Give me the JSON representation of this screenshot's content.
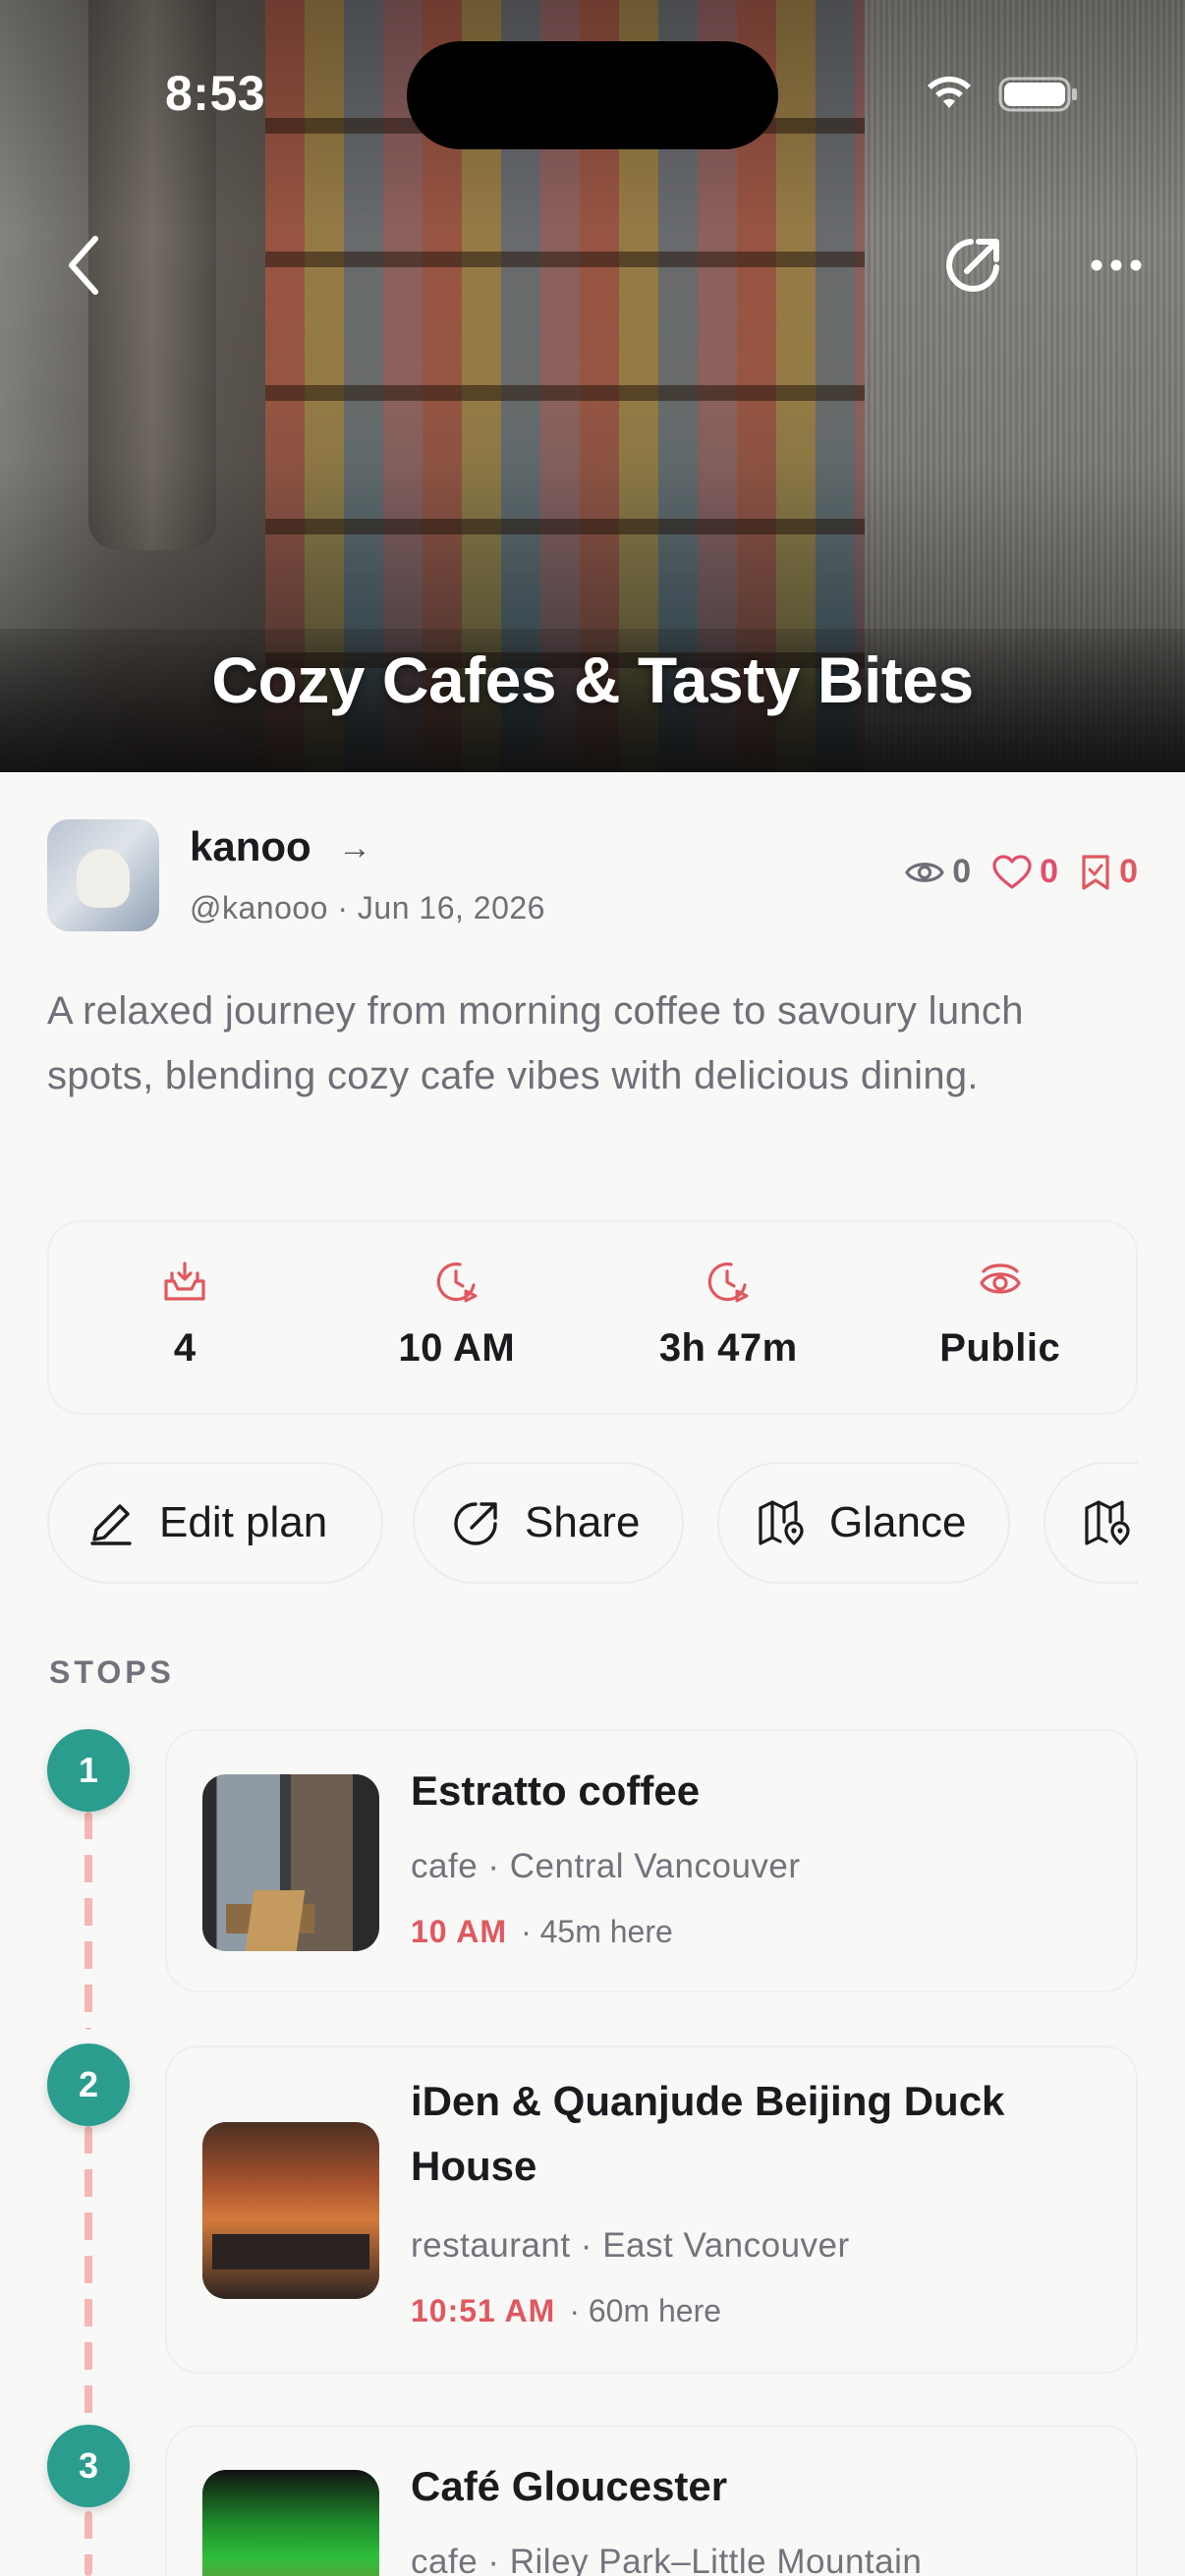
{
  "status_bar": {
    "time": "8:53"
  },
  "hero": {
    "title": "Cozy Cafes & Tasty Bites"
  },
  "author": {
    "name": "kanoo",
    "arrow": "→",
    "handle_date": "@kanooo · Jun 16, 2026",
    "views": "0",
    "likes": "0",
    "saves": "0"
  },
  "description": "A relaxed journey from morning coffee to savoury lunch spots, blending cozy cafe vibes with delicious dining.",
  "summary": {
    "stops": "4",
    "start": "10 AM",
    "duration": "3h 47m",
    "visibility": "Public"
  },
  "actions": {
    "edit": "Edit plan",
    "share": "Share",
    "glance": "Glance"
  },
  "section": {
    "stops_label": "STOPS"
  },
  "stops": [
    {
      "num": "1",
      "name": "Estratto coffee",
      "category": "cafe · Central Vancouver",
      "time": "10 AM",
      "duration": "· 45m here"
    },
    {
      "num": "2",
      "name": "iDen & Quanjude Beijing Duck House",
      "category": "restaurant · East Vancouver",
      "time": "10:51 AM",
      "duration": "· 60m here"
    },
    {
      "num": "3",
      "name": "Café Gloucester",
      "category": "cafe · Riley Park–Little Mountain"
    }
  ],
  "colors": {
    "accent_red": "#e0585f",
    "teal": "#2a9d8f",
    "like_pink": "#e34e6a"
  }
}
